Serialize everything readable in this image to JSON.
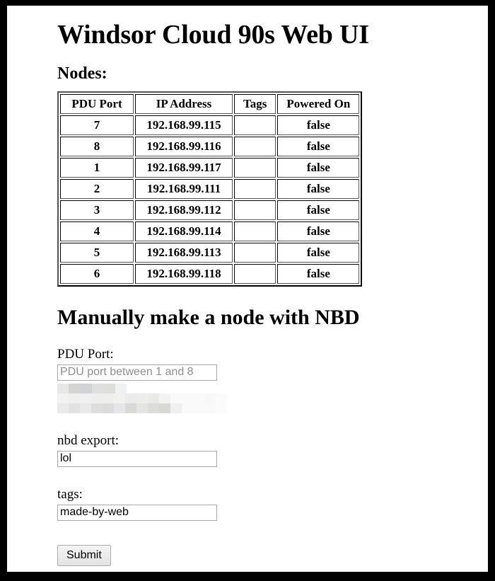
{
  "page": {
    "title": "Windsor Cloud 90s Web UI",
    "nodes_heading": "Nodes:",
    "form_heading": "Manually make a node with NBD"
  },
  "nodes_table": {
    "columns": [
      "PDU Port",
      "IP Address",
      "Tags",
      "Powered On"
    ],
    "rows": [
      {
        "pdu_port": "7",
        "ip_address": "192.168.99.115",
        "tags": "",
        "powered_on": "false"
      },
      {
        "pdu_port": "8",
        "ip_address": "192.168.99.116",
        "tags": "",
        "powered_on": "false"
      },
      {
        "pdu_port": "1",
        "ip_address": "192.168.99.117",
        "tags": "",
        "powered_on": "false"
      },
      {
        "pdu_port": "2",
        "ip_address": "192.168.99.111",
        "tags": "",
        "powered_on": "false"
      },
      {
        "pdu_port": "3",
        "ip_address": "192.168.99.112",
        "tags": "",
        "powered_on": "false"
      },
      {
        "pdu_port": "4",
        "ip_address": "192.168.99.114",
        "tags": "",
        "powered_on": "false"
      },
      {
        "pdu_port": "5",
        "ip_address": "192.168.99.113",
        "tags": "",
        "powered_on": "false"
      },
      {
        "pdu_port": "6",
        "ip_address": "192.168.99.118",
        "tags": "",
        "powered_on": "false"
      }
    ]
  },
  "form": {
    "pdu_port": {
      "label": "PDU Port:",
      "placeholder": "PDU port between 1 and 8",
      "value": ""
    },
    "redacted_field": {
      "label": "",
      "value": ""
    },
    "nbd_export": {
      "label": "nbd export:",
      "placeholder": "",
      "value": "lol"
    },
    "tags": {
      "label": "tags:",
      "placeholder": "",
      "value": "made-by-web"
    },
    "submit_label": "Submit"
  },
  "colors": {
    "page_background": "#ffffff",
    "frame": "#000000",
    "text": "#000000",
    "placeholder": "#8f8f8f",
    "input_border": "#a9a9a9",
    "button_face": "#ececec"
  }
}
